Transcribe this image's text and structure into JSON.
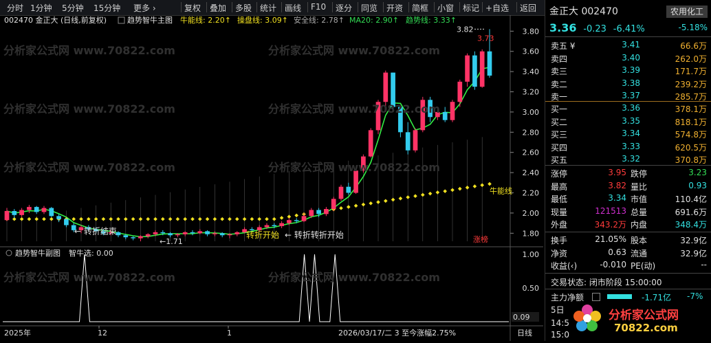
{
  "toolbar": {
    "left": [
      "分时",
      "1分钟",
      "5分钟",
      "15分钟",
      "更多 ›"
    ],
    "right": [
      "复权",
      "叠加",
      "多股",
      "统计",
      "画线",
      "F10",
      "逐分",
      "同览",
      "开资",
      "简框",
      "小窗",
      "标记",
      "+自选",
      "返回"
    ]
  },
  "main_legend": {
    "code_name": "002470 金正大 (日线,前复权)",
    "indicator": "趋势智牛主图",
    "niu_label": "牛能线:",
    "niu_value": "2.20",
    "cao_label": "操盘线:",
    "cao_value": "3.09",
    "safe_label": "安全线:",
    "safe_value": "2.78",
    "ma20_label": "MA20:",
    "ma20_value": "2.90",
    "trend_label": "趋势线:",
    "trend_value": "3.33"
  },
  "sub_legend": {
    "indicator": "趋势智牛副图",
    "label": "智牛选:",
    "value": "0.00"
  },
  "chart_data": [
    {
      "type": "candlestick",
      "title": "002470 金正大 (日线,前复权)",
      "ylim": [
        1.7,
        3.85
      ],
      "y_ticks": [
        "3.80",
        "3.60",
        "3.40",
        "3.20",
        "3.00",
        "2.80",
        "2.60",
        "2.40",
        "2.20",
        "2.00",
        "1.80"
      ],
      "candles": [
        {
          "o": 1.93,
          "c": 2.02,
          "h": 2.05,
          "l": 1.92
        },
        {
          "o": 2.02,
          "c": 1.98,
          "h": 2.04,
          "l": 1.95
        },
        {
          "o": 1.98,
          "c": 2.03,
          "h": 2.05,
          "l": 1.96
        },
        {
          "o": 2.03,
          "c": 2.06,
          "h": 2.08,
          "l": 2.0
        },
        {
          "o": 2.06,
          "c": 2.01,
          "h": 2.07,
          "l": 1.99
        },
        {
          "o": 2.01,
          "c": 2.05,
          "h": 2.07,
          "l": 1.99
        },
        {
          "o": 2.05,
          "c": 1.97,
          "h": 2.06,
          "l": 1.96
        },
        {
          "o": 1.97,
          "c": 1.94,
          "h": 1.99,
          "l": 1.91
        },
        {
          "o": 1.94,
          "c": 1.88,
          "h": 1.95,
          "l": 1.86
        },
        {
          "o": 1.88,
          "c": 1.83,
          "h": 1.9,
          "l": 1.81
        },
        {
          "o": 1.83,
          "c": 1.86,
          "h": 1.88,
          "l": 1.8
        },
        {
          "o": 1.86,
          "c": 1.84,
          "h": 1.88,
          "l": 1.82
        },
        {
          "o": 1.84,
          "c": 1.82,
          "h": 1.86,
          "l": 1.8
        },
        {
          "o": 1.82,
          "c": 1.8,
          "h": 1.84,
          "l": 1.78
        },
        {
          "o": 1.8,
          "c": 1.81,
          "h": 1.83,
          "l": 1.78
        },
        {
          "o": 1.81,
          "c": 1.78,
          "h": 1.82,
          "l": 1.76
        },
        {
          "o": 1.78,
          "c": 1.76,
          "h": 1.79,
          "l": 1.74
        },
        {
          "o": 1.76,
          "c": 1.75,
          "h": 1.77,
          "l": 1.73
        },
        {
          "o": 1.75,
          "c": 1.77,
          "h": 1.78,
          "l": 1.72
        },
        {
          "o": 1.77,
          "c": 1.79,
          "h": 1.8,
          "l": 1.75
        },
        {
          "o": 1.79,
          "c": 1.81,
          "h": 1.83,
          "l": 1.77
        },
        {
          "o": 1.81,
          "c": 1.8,
          "h": 1.83,
          "l": 1.78
        },
        {
          "o": 1.8,
          "c": 1.78,
          "h": 1.81,
          "l": 1.76
        },
        {
          "o": 1.78,
          "c": 1.79,
          "h": 1.8,
          "l": 1.76
        },
        {
          "o": 1.79,
          "c": 1.81,
          "h": 1.82,
          "l": 1.77
        },
        {
          "o": 1.81,
          "c": 1.8,
          "h": 1.83,
          "l": 1.78
        },
        {
          "o": 1.8,
          "c": 1.82,
          "h": 1.84,
          "l": 1.79
        },
        {
          "o": 1.82,
          "c": 1.79,
          "h": 1.83,
          "l": 1.77
        },
        {
          "o": 1.79,
          "c": 1.8,
          "h": 1.82,
          "l": 1.77
        },
        {
          "o": 1.8,
          "c": 1.78,
          "h": 1.81,
          "l": 1.76
        },
        {
          "o": 1.78,
          "c": 1.79,
          "h": 1.8,
          "l": 1.75
        },
        {
          "o": 1.79,
          "c": 1.81,
          "h": 1.82,
          "l": 1.77
        },
        {
          "o": 1.81,
          "c": 1.84,
          "h": 1.86,
          "l": 1.8
        },
        {
          "o": 1.84,
          "c": 1.83,
          "h": 1.86,
          "l": 1.81
        },
        {
          "o": 1.83,
          "c": 1.86,
          "h": 1.88,
          "l": 1.82
        },
        {
          "o": 1.86,
          "c": 1.88,
          "h": 1.9,
          "l": 1.84
        },
        {
          "o": 1.88,
          "c": 1.87,
          "h": 1.9,
          "l": 1.85
        },
        {
          "o": 1.87,
          "c": 1.9,
          "h": 1.92,
          "l": 1.85
        },
        {
          "o": 1.9,
          "c": 1.93,
          "h": 1.95,
          "l": 1.88
        },
        {
          "o": 1.93,
          "c": 1.92,
          "h": 1.95,
          "l": 1.9
        },
        {
          "o": 1.92,
          "c": 1.97,
          "h": 2.0,
          "l": 1.91
        },
        {
          "o": 1.97,
          "c": 2.03,
          "h": 2.05,
          "l": 1.95
        },
        {
          "o": 2.03,
          "c": 1.99,
          "h": 2.05,
          "l": 1.96
        },
        {
          "o": 1.99,
          "c": 2.04,
          "h": 2.06,
          "l": 1.97
        },
        {
          "o": 2.04,
          "c": 2.14,
          "h": 2.16,
          "l": 2.02
        },
        {
          "o": 2.14,
          "c": 2.26,
          "h": 2.28,
          "l": 2.12
        },
        {
          "o": 2.26,
          "c": 2.2,
          "h": 2.3,
          "l": 2.18
        },
        {
          "o": 2.2,
          "c": 2.42,
          "h": 2.44,
          "l": 2.19
        },
        {
          "o": 2.42,
          "c": 2.56,
          "h": 2.58,
          "l": 2.4
        },
        {
          "o": 2.56,
          "c": 2.82,
          "h": 2.84,
          "l": 2.55
        },
        {
          "o": 2.82,
          "c": 3.1,
          "h": 3.12,
          "l": 2.78
        },
        {
          "o": 3.1,
          "c": 3.39,
          "h": 3.41,
          "l": 3.0
        },
        {
          "o": 3.39,
          "c": 3.05,
          "h": 3.39,
          "l": 3.0
        },
        {
          "o": 3.05,
          "c": 2.8,
          "h": 3.05,
          "l": 2.75
        },
        {
          "o": 2.8,
          "c": 2.62,
          "h": 2.9,
          "l": 2.58
        },
        {
          "o": 2.62,
          "c": 2.82,
          "h": 2.84,
          "l": 2.6
        },
        {
          "o": 2.82,
          "c": 3.12,
          "h": 3.15,
          "l": 2.8
        },
        {
          "o": 3.12,
          "c": 2.95,
          "h": 3.15,
          "l": 2.9
        },
        {
          "o": 2.95,
          "c": 3.0,
          "h": 3.02,
          "l": 2.92
        },
        {
          "o": 3.0,
          "c": 2.92,
          "h": 3.05,
          "l": 2.9
        },
        {
          "o": 2.92,
          "c": 3.1,
          "h": 3.12,
          "l": 2.9
        },
        {
          "o": 3.1,
          "c": 3.3,
          "h": 3.32,
          "l": 3.05
        },
        {
          "o": 3.3,
          "c": 3.56,
          "h": 3.58,
          "l": 3.25
        },
        {
          "o": 3.56,
          "c": 3.25,
          "h": 3.6,
          "l": 3.22
        },
        {
          "o": 3.25,
          "c": 3.6,
          "h": 3.62,
          "l": 3.24
        },
        {
          "o": 3.6,
          "c": 3.36,
          "h": 3.82,
          "l": 3.34
        }
      ],
      "ma_lines": [
        "牛能线",
        "操盘线",
        "安全线",
        "MA20",
        "趋势线"
      ],
      "annotations": [
        "3.82",
        "3.73",
        "转折结束",
        "1.71",
        "转折开始",
        "转折转折开始",
        "牛能线",
        "涨榜"
      ],
      "x_labels": [
        "2025年",
        "12",
        "1",
        "2026/03/17/二 3 至今涨幅2.75%",
        "日线"
      ]
    },
    {
      "type": "line",
      "title": "趋势智牛副图",
      "ylim": [
        0.0,
        1.0
      ],
      "y_ticks": [
        "1.00",
        "0.50",
        "0.09"
      ],
      "series": [
        {
          "name": "智牛选",
          "values": [
            0,
            0,
            0,
            0,
            0,
            0,
            0,
            0,
            0,
            0,
            0,
            0,
            0,
            0,
            0,
            0,
            1,
            0,
            0,
            0,
            0,
            0,
            0,
            0,
            0,
            0,
            0,
            0,
            0,
            0,
            0,
            0,
            0,
            0,
            0,
            0,
            0,
            0,
            0,
            0,
            0,
            0,
            0,
            0,
            0,
            0,
            0,
            0,
            0,
            0,
            0,
            0,
            0,
            0,
            0,
            0,
            0,
            0,
            0,
            1,
            0,
            1,
            0,
            0,
            0,
            1,
            0,
            0,
            0,
            0,
            0,
            0,
            0,
            0,
            0,
            0,
            0,
            0,
            0,
            0,
            0,
            0,
            0,
            0,
            0,
            0,
            0,
            0,
            0,
            0,
            0,
            0,
            0,
            0,
            0,
            0,
            0,
            0,
            0,
            0
          ]
        }
      ]
    }
  ],
  "quote": {
    "name": "金正大",
    "code": "002470",
    "sector": "农用化工",
    "price": "3.36",
    "change": "-0.23",
    "pct": "-6.41%",
    "sector_pct": "-5.18%",
    "asks": [
      {
        "label": "卖五 ¥",
        "price": "3.41",
        "vol": "66.6万"
      },
      {
        "label": "卖四",
        "price": "3.40",
        "vol": "262.0万"
      },
      {
        "label": "卖三",
        "price": "3.39",
        "vol": "171.7万"
      },
      {
        "label": "卖二",
        "price": "3.38",
        "vol": "239.2万"
      },
      {
        "label": "卖一",
        "price": "3.37",
        "vol": "285.7万"
      }
    ],
    "bids": [
      {
        "label": "买一",
        "price": "3.36",
        "vol": "378.1万"
      },
      {
        "label": "买二",
        "price": "3.35",
        "vol": "818.1万"
      },
      {
        "label": "买三",
        "price": "3.34",
        "vol": "574.8万"
      },
      {
        "label": "买四",
        "price": "3.33",
        "vol": "620.5万"
      },
      {
        "label": "买五",
        "price": "3.32",
        "vol": "370.8万"
      }
    ],
    "stats": [
      {
        "l1": "涨停",
        "v1": "3.95",
        "c1": "red",
        "l2": "跌停",
        "v2": "3.23",
        "c2": "green"
      },
      {
        "l1": "最高",
        "v1": "3.82",
        "c1": "red",
        "l2": "量比",
        "v2": "0.93",
        "c2": "cyan"
      },
      {
        "l1": "最低",
        "v1": "3.34",
        "c1": "cyan",
        "l2": "市值",
        "v2": "110.4亿",
        "c2": "white"
      },
      {
        "l1": "现量",
        "v1": "121513",
        "c1": "purple",
        "l2": "总量",
        "v2": "691.6万",
        "c2": "white"
      },
      {
        "l1": "外盘",
        "v1": "343.2万",
        "c1": "red",
        "l2": "内盘",
        "v2": "348.4万",
        "c2": "cyan"
      }
    ],
    "stats2": [
      {
        "l1": "换手",
        "v1": "21.05%",
        "l2": "股本",
        "v2": "32.9亿"
      },
      {
        "l1": "净资",
        "v1": "0.63",
        "l2": "流通",
        "v2": "32.9亿"
      },
      {
        "l1": "收益(‹)",
        "v1": "-0.010",
        "l2": "PE(动)",
        "v2": "--"
      }
    ],
    "trade_status": "交易状态: 闭市阶段 15:00:00",
    "main_flow_label": "主力净额",
    "main_flow_value": "-1.71亿",
    "main_flow_pct": "-7%",
    "day_label": "5日",
    "time_label": "14:5",
    "time_label2": "15:0"
  },
  "watermark": {
    "text": "分析家公式网 www.70822.com",
    "logo_text": "分析家公式网",
    "logo_url": "70822.com"
  }
}
